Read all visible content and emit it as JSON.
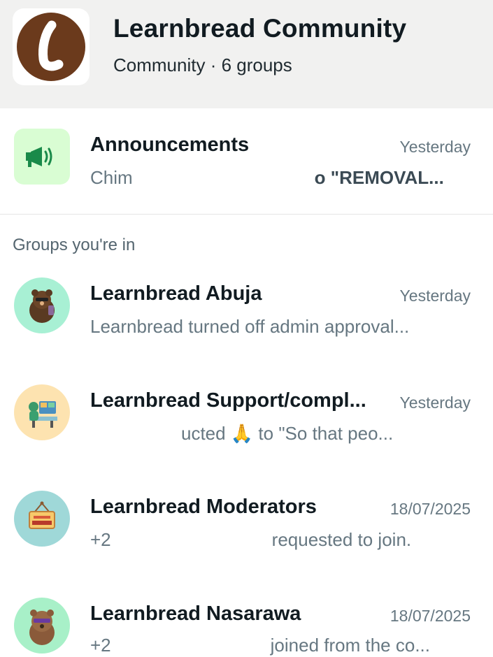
{
  "header": {
    "title": "Learnbread Community",
    "subtitle": "Community · 6 groups"
  },
  "announcements": {
    "name": "Announcements",
    "time": "Yesterday",
    "preview_start": "Chim",
    "preview_end": "o \"REMOVAL..."
  },
  "section_label": "Groups you're in",
  "groups": [
    {
      "name": "Learnbread Abuja",
      "time": "Yesterday",
      "preview": "Learnbread turned off admin approval..."
    },
    {
      "name": "Learnbread Support/compl...",
      "time": "Yesterday",
      "preview_start": "",
      "preview_mid": "ucted 🙏 to \"So that peo..."
    },
    {
      "name": "Learnbread Moderators",
      "time": "18/07/2025",
      "preview_start": "+2",
      "preview_end": "requested to join."
    },
    {
      "name": "Learnbread Nasarawa",
      "time": "18/07/2025",
      "preview_start": "+2",
      "preview_end": "joined from the co..."
    }
  ],
  "colors": {
    "header_bg": "#f1f1f0",
    "logo_brown": "#6b3a1c",
    "announce_green": "#d9fdd3",
    "megaphone": "#1a8a4a",
    "timestamp": "#667781"
  },
  "icons": {
    "logo": "learnbread-logo-icon",
    "announcements": "megaphone-icon",
    "abuja": "bear-avatar-icon",
    "support": "support-desk-avatar-icon",
    "moderators": "open-sign-avatar-icon",
    "nasarawa": "bear-sunglasses-avatar-icon"
  }
}
